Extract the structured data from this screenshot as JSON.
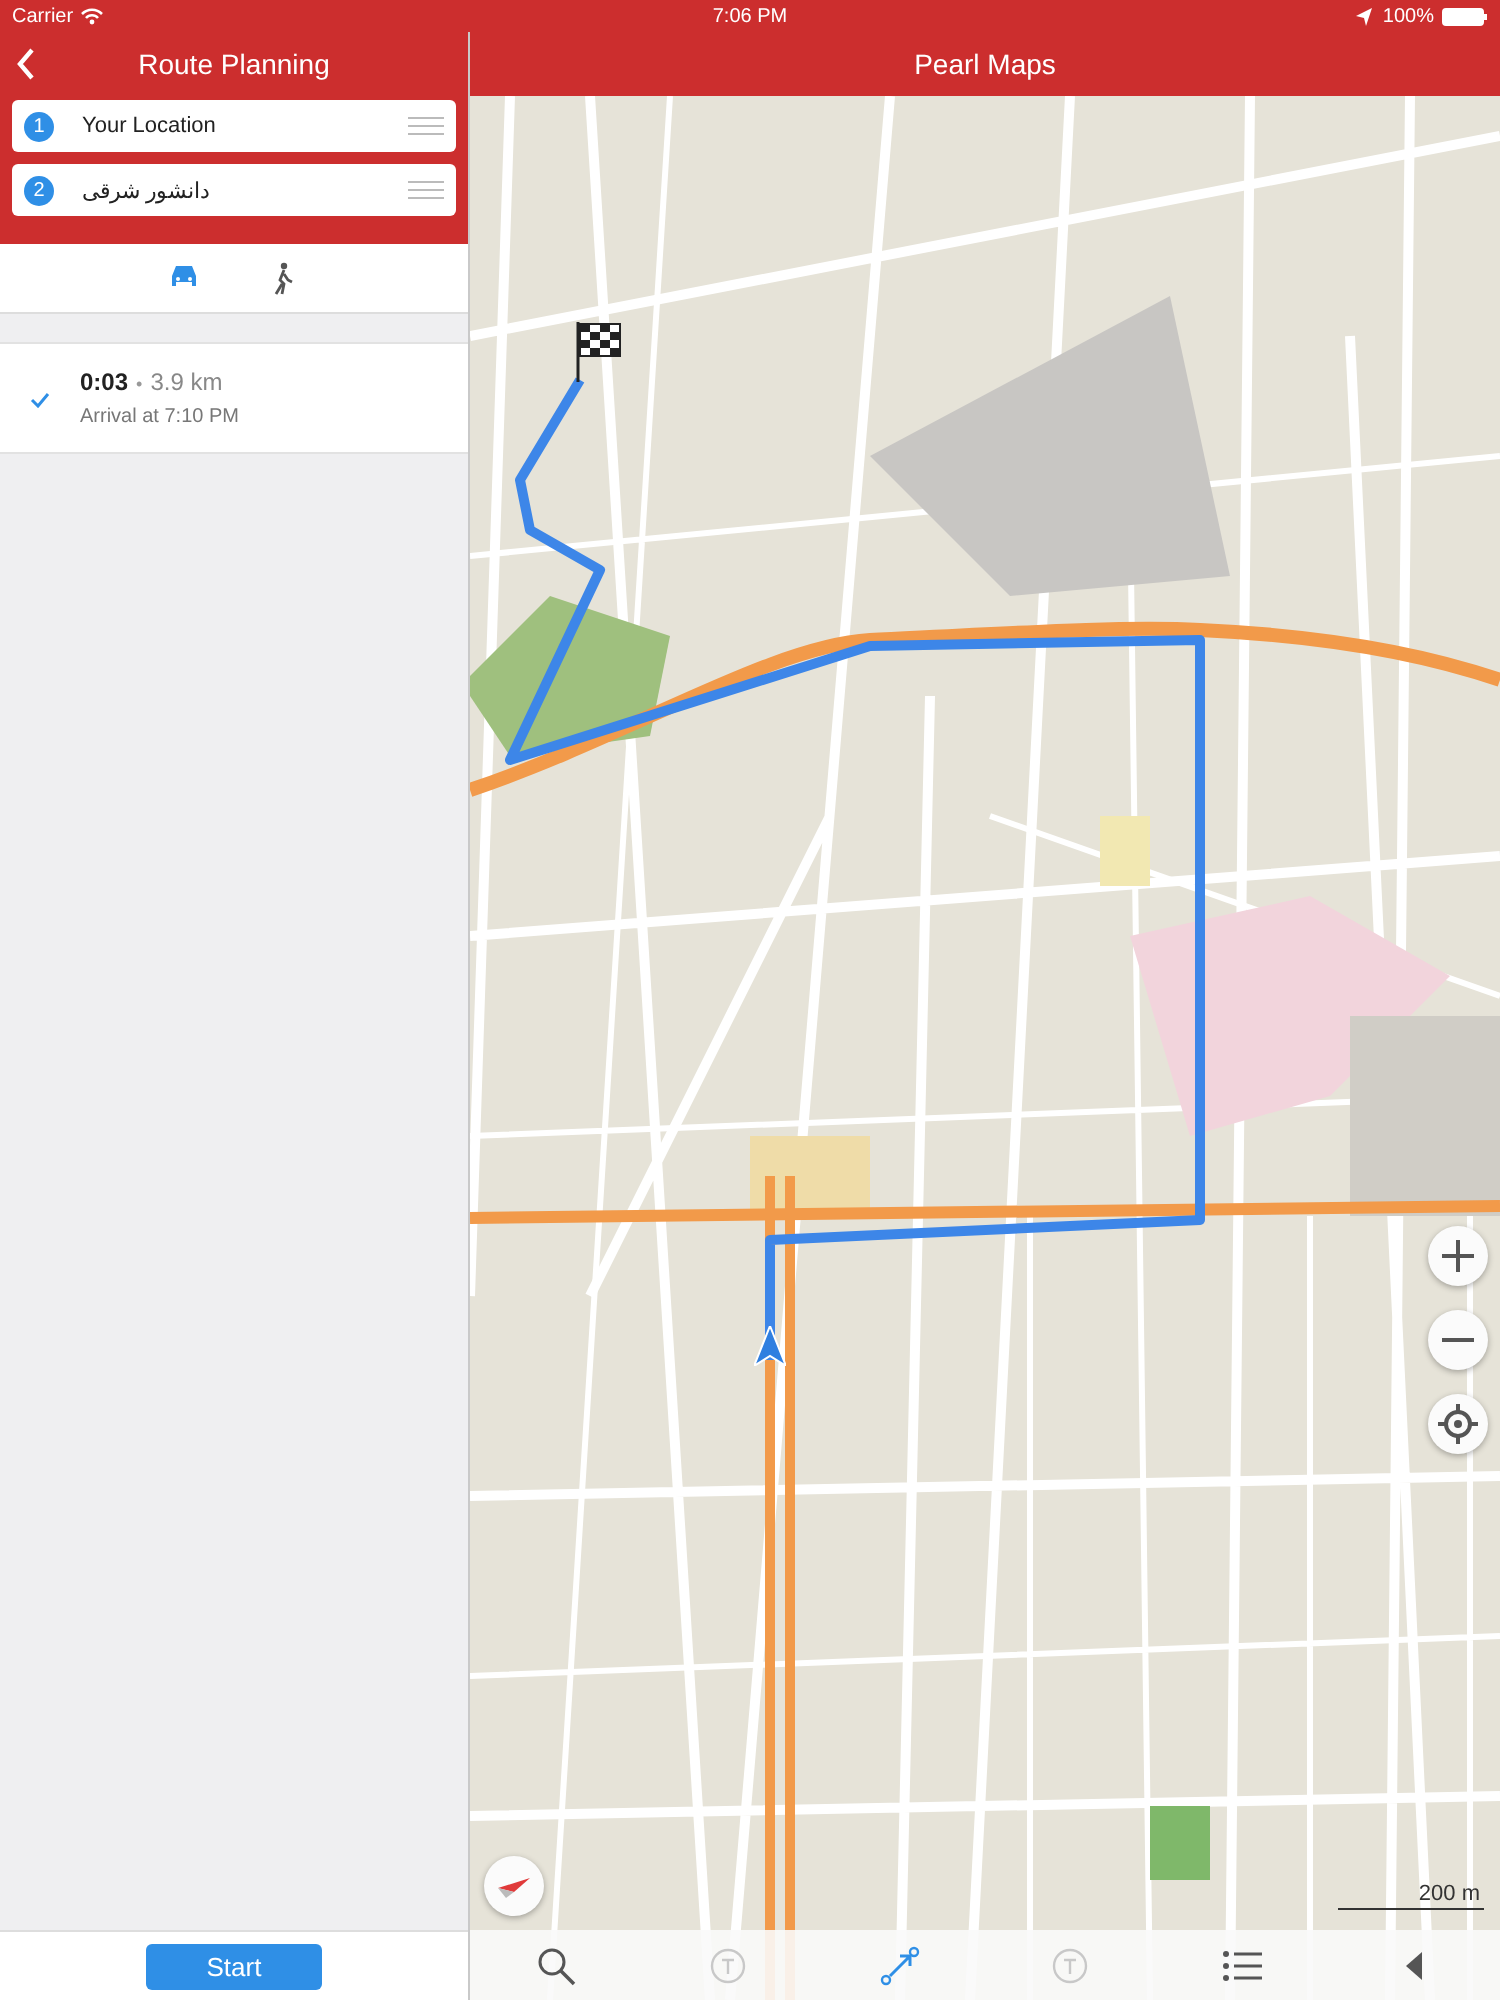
{
  "status_bar": {
    "carrier": "Carrier",
    "time": "7:06 PM",
    "battery": "100%"
  },
  "route_panel": {
    "title": "Route Planning",
    "stops": [
      {
        "number": "1",
        "label": "Your Location"
      },
      {
        "number": "2",
        "label": "دانشور شرقی"
      }
    ],
    "modes": [
      {
        "kind": "car",
        "selected": true
      },
      {
        "kind": "walk",
        "selected": false
      }
    ],
    "routes": [
      {
        "selected": true,
        "duration": "0:03",
        "separator": "•",
        "distance": "3.9 km",
        "arrival": "Arrival at 7:10 PM"
      }
    ],
    "start_button": "Start"
  },
  "map": {
    "title": "Pearl Maps",
    "scale": "200 m",
    "toolbar": [
      {
        "kind": "search",
        "selected": false
      },
      {
        "kind": "traffic",
        "selected": false
      },
      {
        "kind": "route",
        "selected": true
      },
      {
        "kind": "traffic",
        "selected": false
      },
      {
        "kind": "list",
        "selected": false
      },
      {
        "kind": "collapse",
        "selected": false
      }
    ]
  }
}
